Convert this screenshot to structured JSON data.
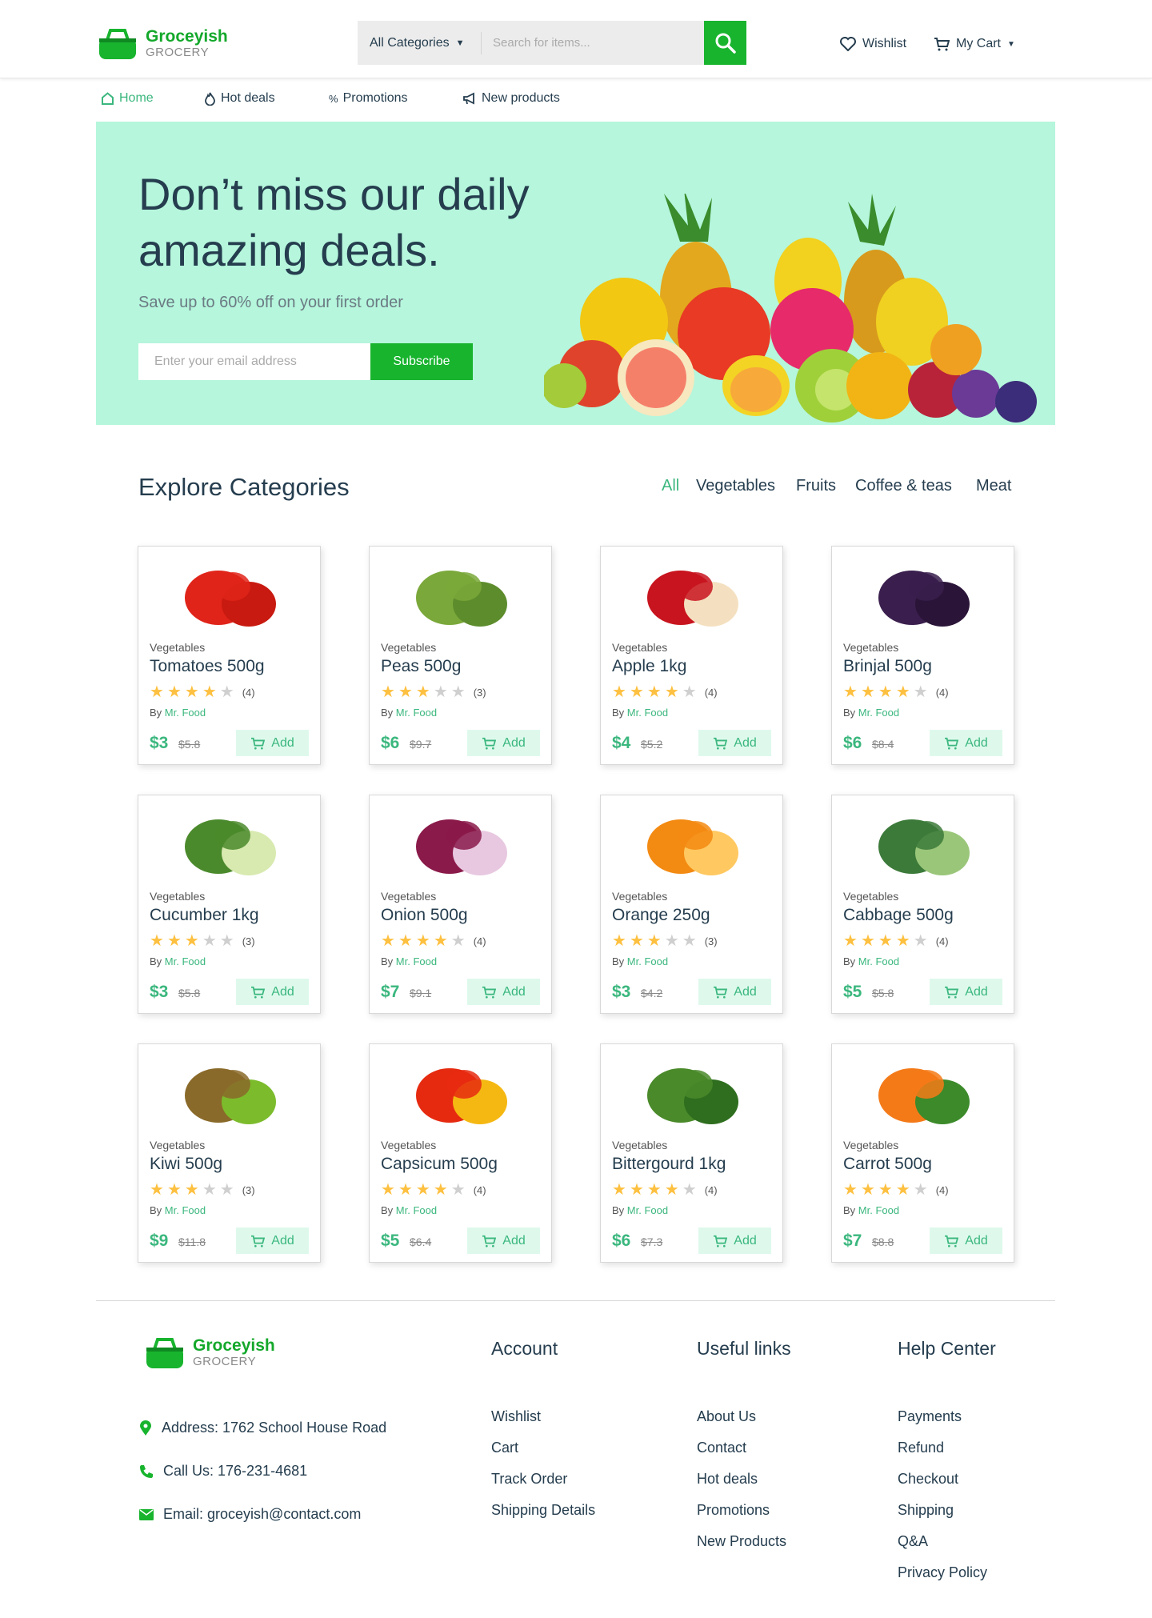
{
  "brand": {
    "name": "Groceyish",
    "tagline": "GROCERY"
  },
  "search": {
    "category": "All Categories",
    "placeholder": "Search for items..."
  },
  "header": {
    "wishlist": "Wishlist",
    "cart": "My Cart"
  },
  "nav": {
    "home": "Home",
    "hot_deals": "Hot deals",
    "promotions": "Promotions",
    "new_products": "New products"
  },
  "hero": {
    "title": "Don’t miss our daily amazing deals.",
    "subtitle": "Save up to 60% off on your first order",
    "email_placeholder": "Enter your email address",
    "subscribe": "Subscribe"
  },
  "categories": {
    "title": "Explore Categories",
    "tabs": [
      "All",
      "Vegetables",
      "Fruits",
      "Coffee & teas",
      "Meat"
    ]
  },
  "products": [
    {
      "category": "Vegetables",
      "name": "Tomatoes 500g",
      "rating": 4,
      "count": "(4)",
      "seller": "Mr. Food",
      "price": "$3",
      "old_price": "$5.8",
      "add": "Add"
    },
    {
      "category": "Vegetables",
      "name": "Peas 500g",
      "rating": 3,
      "count": "(3)",
      "seller": "Mr. Food",
      "price": "$6",
      "old_price": "$9.7",
      "add": "Add"
    },
    {
      "category": "Vegetables",
      "name": "Apple 1kg",
      "rating": 4,
      "count": "(4)",
      "seller": "Mr. Food",
      "price": "$4",
      "old_price": "$5.2",
      "add": "Add"
    },
    {
      "category": "Vegetables",
      "name": "Brinjal 500g",
      "rating": 4,
      "count": "(4)",
      "seller": "Mr. Food",
      "price": "$6",
      "old_price": "$8.4",
      "add": "Add"
    },
    {
      "category": "Vegetables",
      "name": "Cucumber 1kg",
      "rating": 3,
      "count": "(3)",
      "seller": "Mr. Food",
      "price": "$3",
      "old_price": "$5.8",
      "add": "Add"
    },
    {
      "category": "Vegetables",
      "name": "Onion 500g",
      "rating": 4,
      "count": "(4)",
      "seller": "Mr. Food",
      "price": "$7",
      "old_price": "$9.1",
      "add": "Add"
    },
    {
      "category": "Vegetables",
      "name": "Orange 250g",
      "rating": 3,
      "count": "(3)",
      "seller": "Mr. Food",
      "price": "$3",
      "old_price": "$4.2",
      "add": "Add"
    },
    {
      "category": "Vegetables",
      "name": "Cabbage 500g",
      "rating": 4,
      "count": "(4)",
      "seller": "Mr. Food",
      "price": "$5",
      "old_price": "$5.8",
      "add": "Add"
    },
    {
      "category": "Vegetables",
      "name": "Kiwi 500g",
      "rating": 3,
      "count": "(3)",
      "seller": "Mr. Food",
      "price": "$9",
      "old_price": "$11.8",
      "add": "Add"
    },
    {
      "category": "Vegetables",
      "name": "Capsicum 500g",
      "rating": 4,
      "count": "(4)",
      "seller": "Mr. Food",
      "price": "$5",
      "old_price": "$6.4",
      "add": "Add"
    },
    {
      "category": "Vegetables",
      "name": "Bittergourd 1kg",
      "rating": 4,
      "count": "(4)",
      "seller": "Mr. Food",
      "price": "$6",
      "old_price": "$7.3",
      "add": "Add"
    },
    {
      "category": "Vegetables",
      "name": "Carrot 500g",
      "rating": 4,
      "count": "(4)",
      "seller": "Mr. Food",
      "price": "$7",
      "old_price": "$8.8",
      "add": "Add"
    }
  ],
  "by_label": "By",
  "footer": {
    "address": "Address: 1762 School House Road",
    "phone": "Call Us: 176-231-4681",
    "email": "Email: groceyish@contact.com",
    "columns": [
      {
        "title": "Account",
        "links": [
          "Wishlist",
          "Cart",
          "Track Order",
          "Shipping Details"
        ]
      },
      {
        "title": "Useful links",
        "links": [
          "About Us",
          "Contact",
          "Hot deals",
          "Promotions",
          "New Products"
        ]
      },
      {
        "title": "Help Center",
        "links": [
          "Payments",
          "Refund",
          "Checkout",
          "Shipping",
          "Q&A",
          "Privacy Policy"
        ]
      }
    ]
  },
  "colors": {
    "brand_green": "#18b42e",
    "accent": "#3bb77e",
    "hero_bg": "#b5f6dc",
    "star": "#fdc040"
  }
}
